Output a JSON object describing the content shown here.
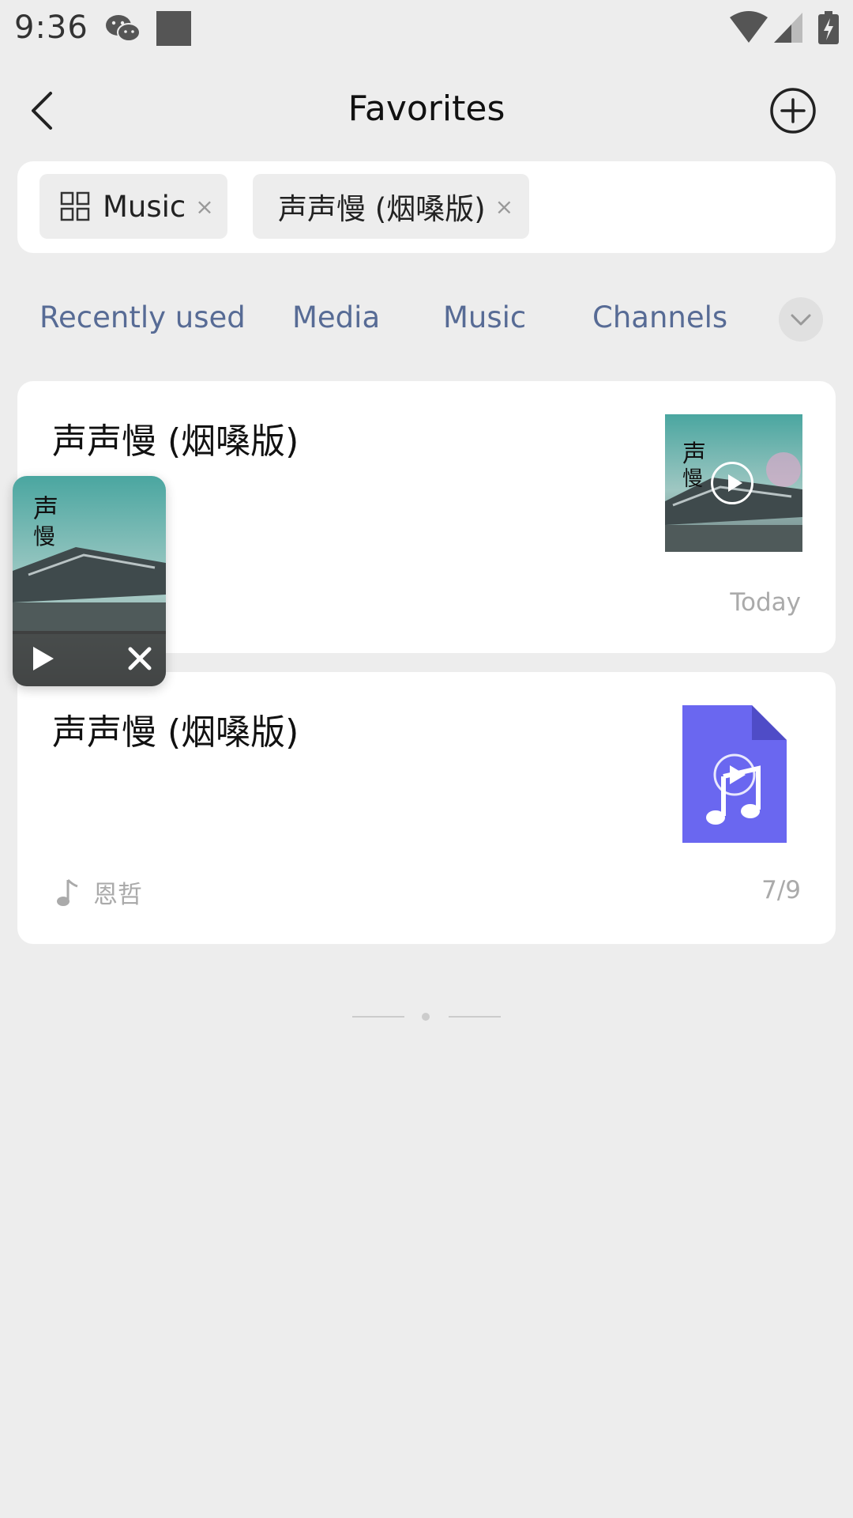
{
  "status_bar": {
    "time": "9:36"
  },
  "header": {
    "title": "Favorites"
  },
  "filters": {
    "chips": [
      {
        "label": "Music",
        "icon": "grid-icon"
      },
      {
        "label": "声声慢 (烟嗓版)"
      }
    ],
    "remove_glyph": "×"
  },
  "tabs": {
    "items": [
      "Recently used",
      "Media",
      "Music",
      "Channels"
    ]
  },
  "cards": [
    {
      "title": "声声慢 (烟嗓版)",
      "date": "Today",
      "thumbnail": "album-art"
    },
    {
      "title": "声声慢 (烟嗓版)",
      "artist": "恩哲",
      "date": "7/9",
      "thumbnail": "music-file-icon"
    }
  ],
  "colors": {
    "background": "#ededed",
    "card": "#ffffff",
    "tab_link": "#576b95",
    "file_icon": "#6a67f0",
    "muted_text": "#aaaaaa"
  }
}
